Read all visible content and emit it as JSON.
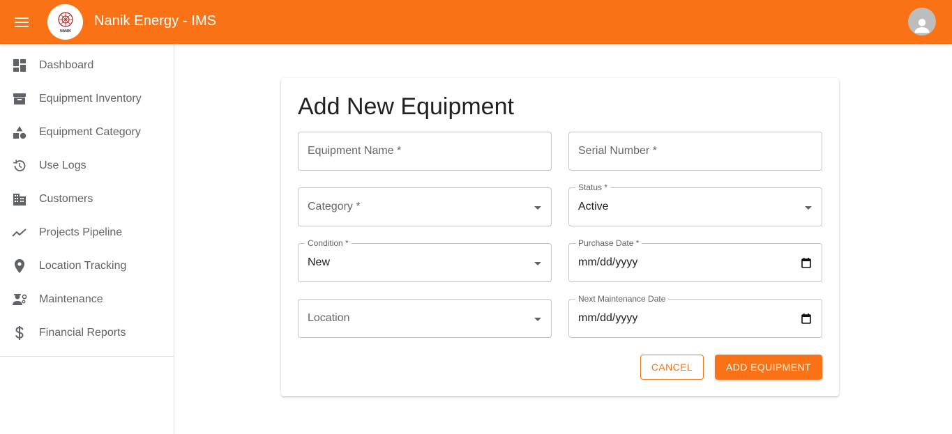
{
  "app": {
    "title": "Nanik Energy - IMS",
    "logo_text": "NANIK"
  },
  "colors": {
    "brand": "#f97316",
    "text": "#212121",
    "muted": "#5f6368"
  },
  "sidebar": {
    "items": [
      {
        "label": "Dashboard",
        "icon": "dashboard-icon"
      },
      {
        "label": "Equipment Inventory",
        "icon": "inventory-icon"
      },
      {
        "label": "Equipment Category",
        "icon": "category-icon"
      },
      {
        "label": "Use Logs",
        "icon": "history-icon"
      },
      {
        "label": "Customers",
        "icon": "building-icon"
      },
      {
        "label": "Projects Pipeline",
        "icon": "trending-icon"
      },
      {
        "label": "Location Tracking",
        "icon": "location-pin-icon"
      },
      {
        "label": "Maintenance",
        "icon": "engineering-icon"
      },
      {
        "label": "Financial Reports",
        "icon": "dollar-icon"
      }
    ]
  },
  "form": {
    "title": "Add New Equipment",
    "equipment_name": {
      "placeholder": "Equipment Name *",
      "value": ""
    },
    "serial_number": {
      "placeholder": "Serial Number *",
      "value": ""
    },
    "category": {
      "placeholder": "Category *",
      "value": ""
    },
    "status": {
      "label": "Status *",
      "value": "Active"
    },
    "condition": {
      "label": "Condition *",
      "value": "New"
    },
    "purchase_date": {
      "label": "Purchase Date *",
      "value": "mm/dd/yyyy"
    },
    "location": {
      "placeholder": "Location",
      "value": ""
    },
    "next_maintenance_date": {
      "label": "Next Maintenance Date",
      "value": "mm/dd/yyyy"
    },
    "cancel_label": "CANCEL",
    "submit_label": "ADD EQUIPMENT"
  }
}
